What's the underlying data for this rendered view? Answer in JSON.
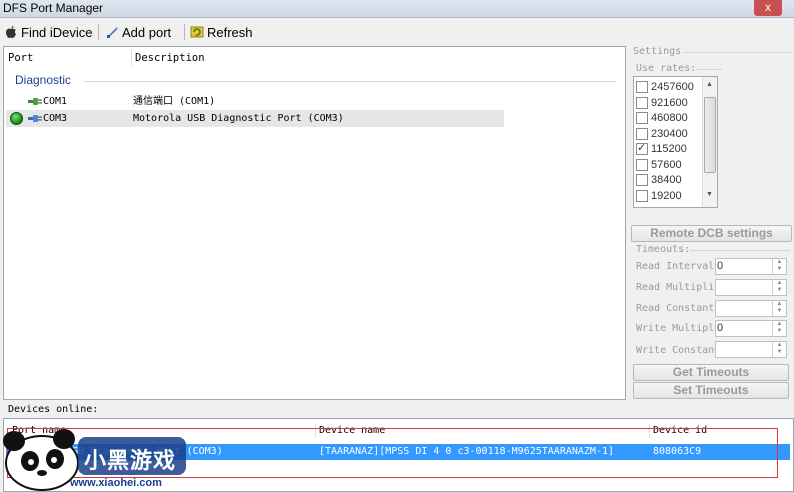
{
  "window": {
    "title": "DFS Port Manager",
    "close_glyph": "x"
  },
  "toolbar": {
    "find_label": "Find iDevice",
    "add_label": "Add port",
    "refresh_label": "Refresh"
  },
  "port_list": {
    "columns": [
      "Port",
      "Description"
    ],
    "group": "Diagnostic",
    "rows": [
      {
        "port": "COM1",
        "description": "通信端口 (COM1)"
      },
      {
        "port": "COM3",
        "description": "Motorola USB Diagnostic Port (COM3)"
      }
    ]
  },
  "settings": {
    "title": "Settings",
    "use_rates_label": "Use rates:",
    "rates": [
      {
        "value": "2457600",
        "checked": false
      },
      {
        "value": "921600",
        "checked": false
      },
      {
        "value": "460800",
        "checked": false
      },
      {
        "value": "230400",
        "checked": false
      },
      {
        "value": "115200",
        "checked": true
      },
      {
        "value": "57600",
        "checked": false
      },
      {
        "value": "38400",
        "checked": false
      },
      {
        "value": "19200",
        "checked": false
      }
    ],
    "remote_dcb_label": "Remote DCB settings",
    "timeouts_label": "Timeouts:",
    "timeouts": [
      {
        "label": "Read Interval",
        "value": "0"
      },
      {
        "label": "Read Multiplier:",
        "value": ""
      },
      {
        "label": "Read Constant:",
        "value": ""
      },
      {
        "label": "Write Multipli",
        "value": "0"
      },
      {
        "label": "Write Constant:",
        "value": ""
      }
    ],
    "get_timeouts_label": "Get Timeouts",
    "set_timeouts_label": "Set Timeouts"
  },
  "devices": {
    "label": "Devices online:",
    "columns": [
      "Port name",
      "Device name",
      "Device id"
    ],
    "rows": [
      {
        "port_name": "Motorola USB Diagnostic Port (COM3)",
        "device_name": "[TAARANAZ][MPSS DI 4 0 c3-00118-M9625TAARANAZM-1]",
        "device_id": "808063C9"
      }
    ]
  },
  "watermark": {
    "title": "小黑游戏",
    "url": "www.xiaohei.com"
  },
  "colors": {
    "selection": "#3399ff",
    "group_title": "#1e3f8c",
    "highlight_box": "#d63a3a"
  }
}
